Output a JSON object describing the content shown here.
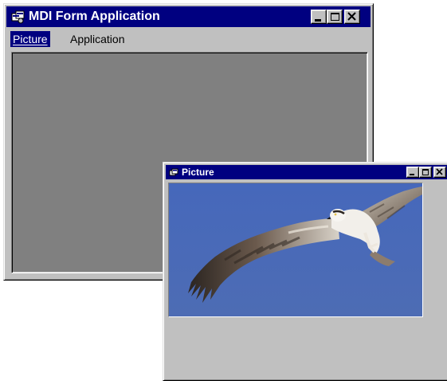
{
  "main_window": {
    "title": "MDI Form Application",
    "menu": {
      "picture": "Picture",
      "application": "Application"
    }
  },
  "child_window": {
    "title": "Picture",
    "image_subject": "osprey-in-flight"
  },
  "colors": {
    "title_bar": "#000080",
    "face": "#c0c0c0",
    "mdi_background": "#808080",
    "sky": "#4a6bb8"
  }
}
